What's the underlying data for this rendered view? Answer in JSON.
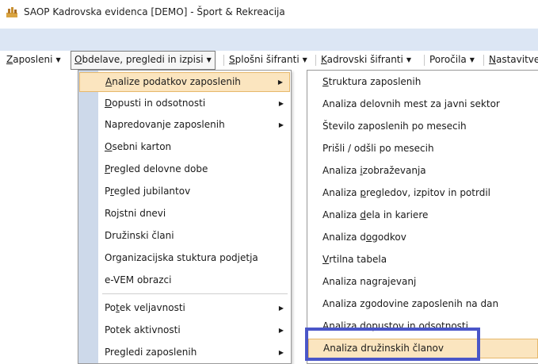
{
  "window": {
    "title": "SAOP Kadrovska evidenca  [DEMO] - Šport & Rekreacija",
    "icon": "saop-app-icon"
  },
  "menubar": {
    "items": [
      {
        "label": "Zaposleni",
        "mnemonic": "Z",
        "rest": "aposleni"
      },
      {
        "label": "Obdelave, pregledi in izpisi",
        "mnemonic": "O",
        "rest": "bdelave, pregledi in izpisi"
      },
      {
        "label": "Splošni šifranti",
        "mnemonic": "S",
        "rest": "plošni šifranti"
      },
      {
        "label": "Kadrovski šifranti",
        "mnemonic": "K",
        "rest": "adrovski šifranti"
      },
      {
        "label": "Poročila",
        "mnemonic": "",
        "rest": "Poročila"
      },
      {
        "label": "Nastavitve",
        "mnemonic": "N",
        "rest": "astavitve"
      }
    ],
    "caret": "▼"
  },
  "submenu1": {
    "items": [
      {
        "pre": "",
        "key": "A",
        "post": "nalize podatkov zaposlenih",
        "has_sub": true
      },
      {
        "pre": "",
        "key": "D",
        "post": "opusti in odsotnosti",
        "has_sub": true
      },
      {
        "pre": "Napredovanje zaposlenih",
        "key": "",
        "post": "",
        "has_sub": true
      },
      {
        "pre": "",
        "key": "O",
        "post": "sebni karton",
        "has_sub": false
      },
      {
        "pre": "",
        "key": "P",
        "post": "regled delovne dobe",
        "has_sub": false
      },
      {
        "pre": "P",
        "key": "r",
        "post": "egled jubilantov",
        "has_sub": false
      },
      {
        "pre": "Ro",
        "key": "j",
        "post": "stni dnevi",
        "has_sub": false
      },
      {
        "pre": "Družinski člani",
        "key": "",
        "post": "",
        "has_sub": false
      },
      {
        "pre": "Organizacijska stuktura podjetja",
        "key": "",
        "post": "",
        "has_sub": false
      },
      {
        "pre": "e-VEM obrazci",
        "key": "",
        "post": "",
        "has_sub": false
      },
      {
        "pre": "Po",
        "key": "t",
        "post": "ek veljavnosti",
        "has_sub": true
      },
      {
        "pre": "Potek aktivnosti",
        "key": "",
        "post": "",
        "has_sub": true
      },
      {
        "pre": "Pregledi zaposlenih",
        "key": "",
        "post": "",
        "has_sub": true
      }
    ],
    "arrow": "▶"
  },
  "submenu2": {
    "items": [
      {
        "pre": "",
        "key": "S",
        "post": "truktura zaposlenih"
      },
      {
        "pre": "Analiza delovnih mest za javni sektor",
        "key": "",
        "post": ""
      },
      {
        "pre": "Število zaposlenih po mesecih",
        "key": "",
        "post": ""
      },
      {
        "pre": "Prišli / odšli po mesecih",
        "key": "",
        "post": ""
      },
      {
        "pre": "Analiza ",
        "key": "i",
        "post": "zobraževanja"
      },
      {
        "pre": "Analiza ",
        "key": "p",
        "post": "regledov, izpitov in potrdil"
      },
      {
        "pre": "Analiza ",
        "key": "d",
        "post": "ela in kariere"
      },
      {
        "pre": "Analiza d",
        "key": "o",
        "post": "godkov"
      },
      {
        "pre": "",
        "key": "V",
        "post": "rtilna tabela"
      },
      {
        "pre": "Analiza nagrajevanj",
        "key": "",
        "post": ""
      },
      {
        "pre": "Analiza zgodovine zaposlenih na dan",
        "key": "",
        "post": ""
      },
      {
        "pre": "Analiza dopustov in odsotnosti",
        "key": "",
        "post": ""
      },
      {
        "pre": "Analiza družinskih članov",
        "key": "",
        "post": ""
      }
    ]
  }
}
